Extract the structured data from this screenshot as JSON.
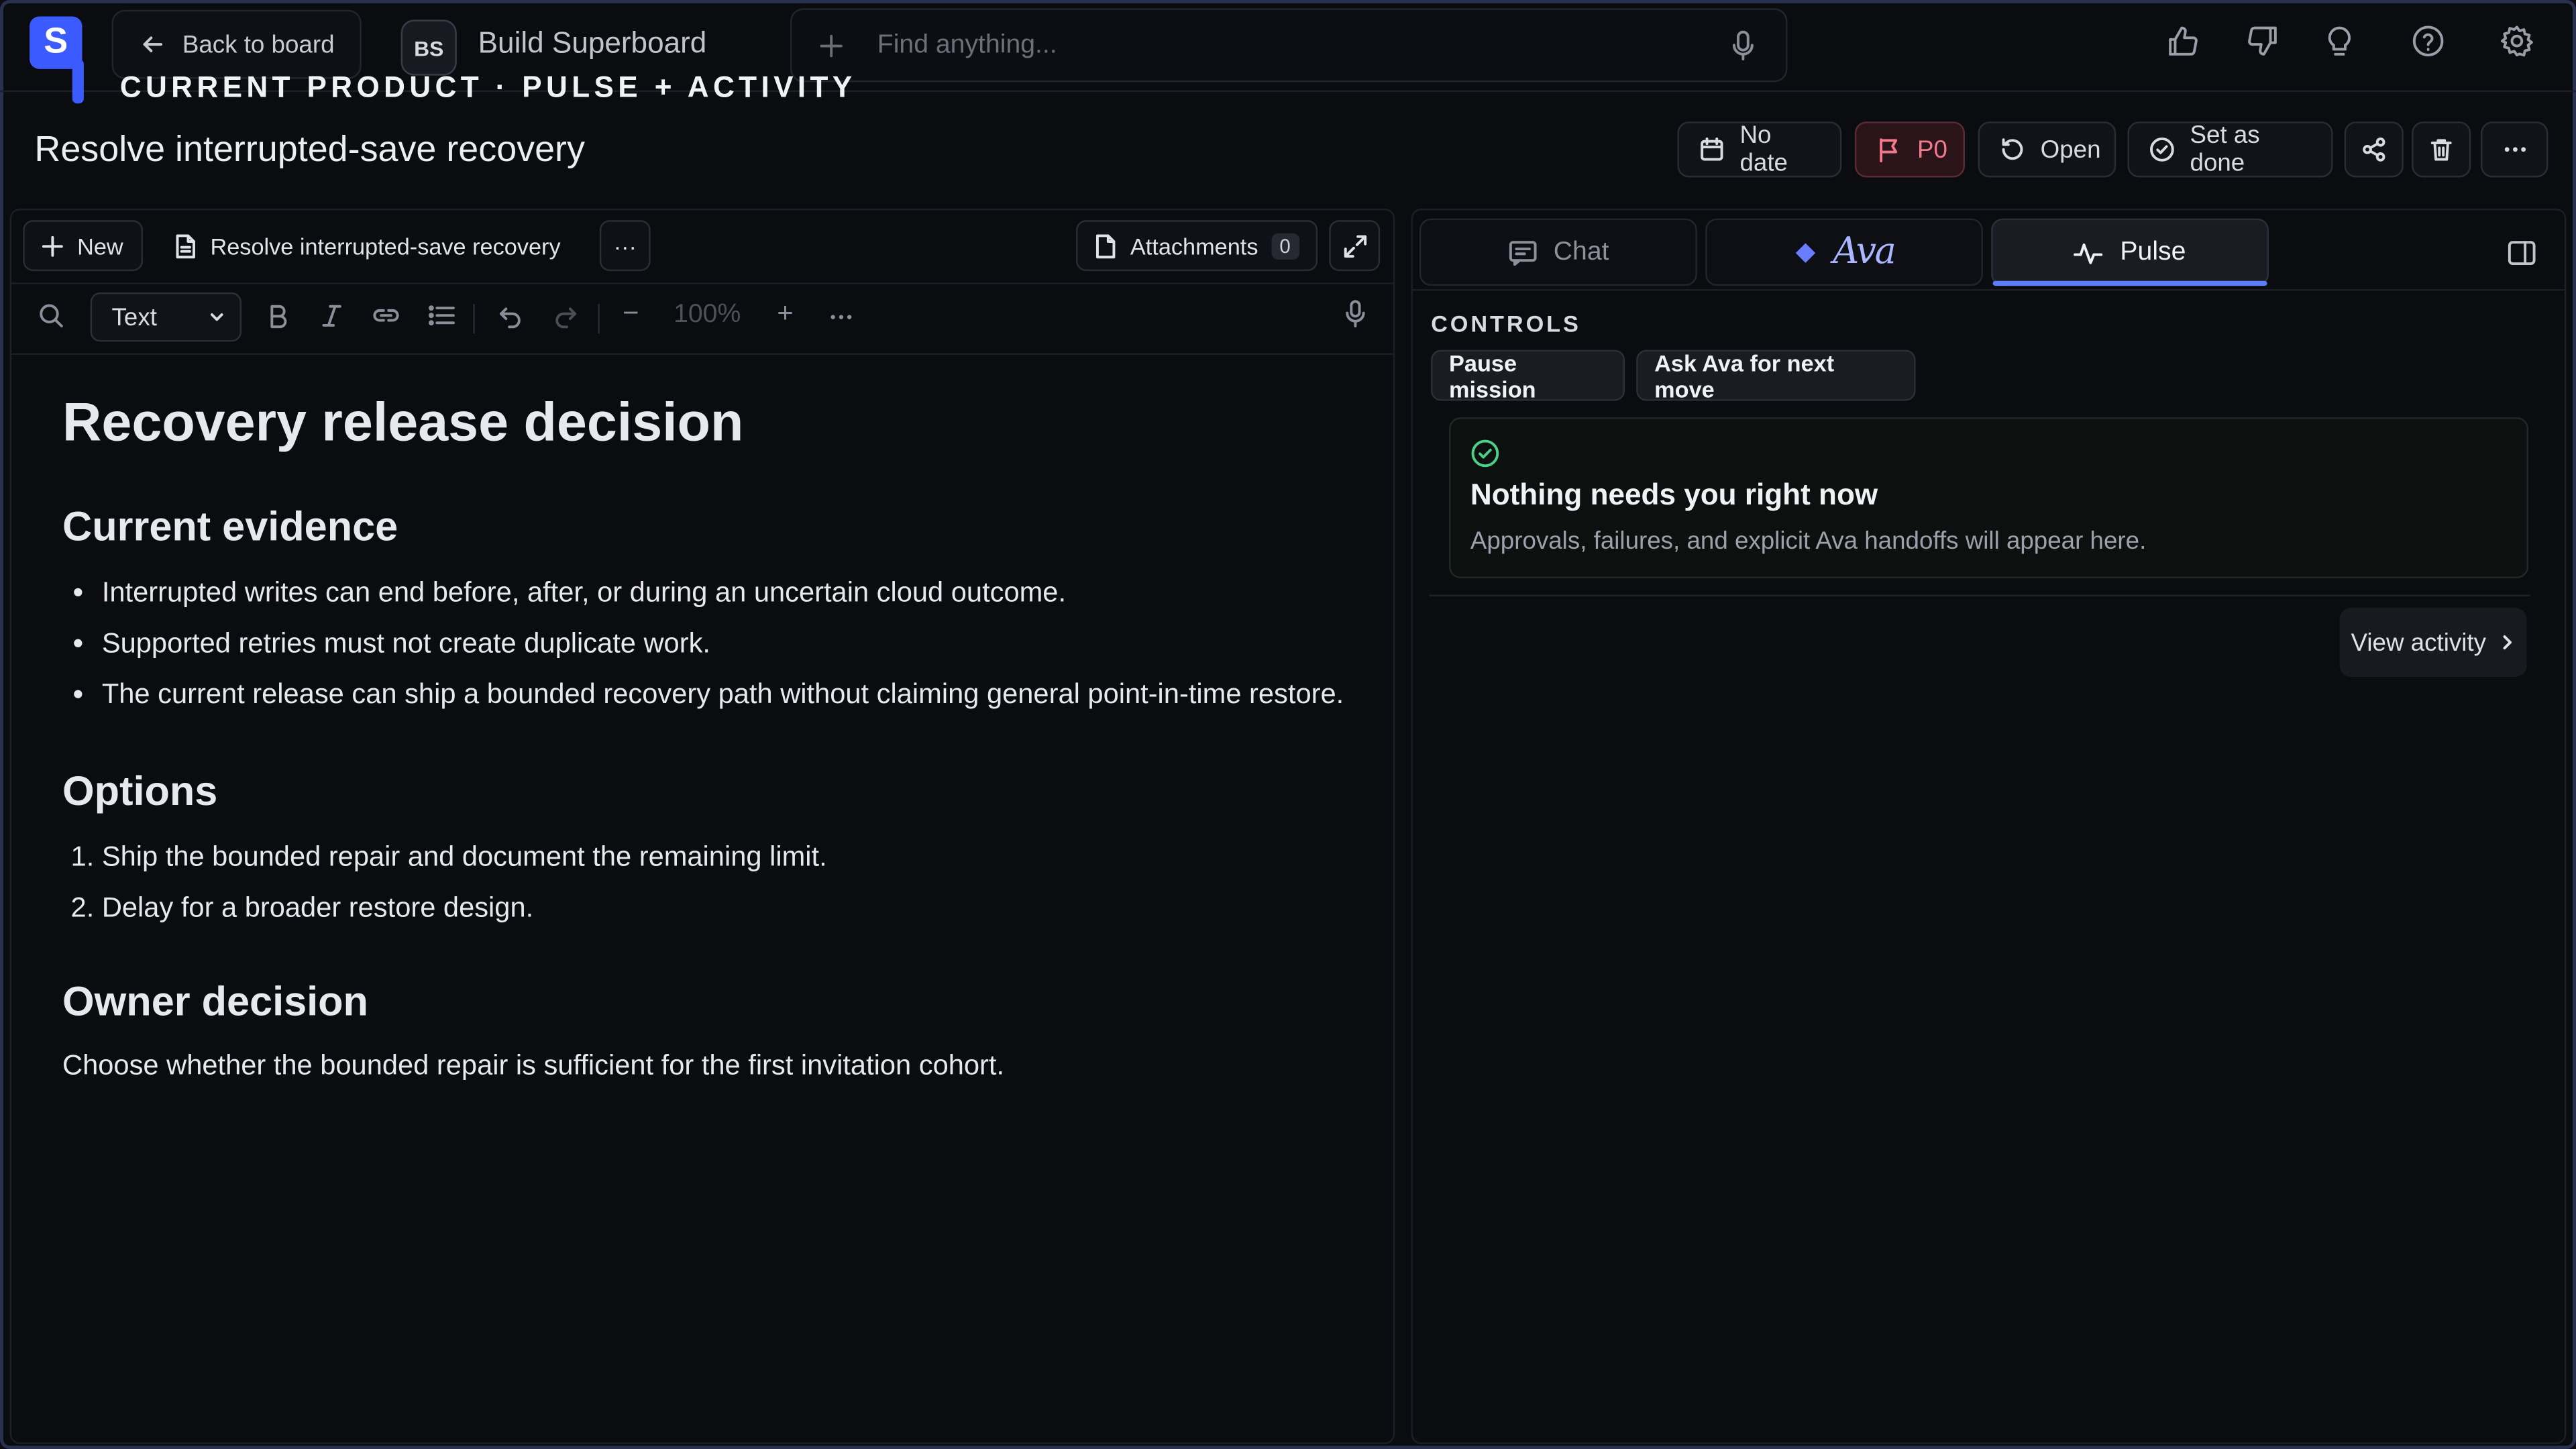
{
  "app": {
    "logo_letter": "S",
    "back_label": "Back to board",
    "project_initials": "BS",
    "project_name": "Build Superboard",
    "search_placeholder": "Find anything...",
    "section_label": "CURRENT PRODUCT · PULSE + ACTIVITY"
  },
  "task": {
    "title": "Resolve interrupted-save recovery",
    "date_label": "No date",
    "priority_label": "P0",
    "status_label": "Open",
    "done_label": "Set as done"
  },
  "editor": {
    "new_label": "New",
    "doc_tab_label": "Resolve interrupted-save recovery",
    "more_label": "···",
    "attachments_label": "Attachments",
    "attachments_count": "0",
    "format_select": "Text",
    "zoom_label": "100%",
    "zoom_minus": "−",
    "zoom_plus": "+"
  },
  "document": {
    "title": "Recovery release decision",
    "sections": [
      {
        "heading": "Current evidence",
        "bullets": [
          "Interrupted writes can end before, after, or during an uncertain cloud outcome.",
          "Supported retries must not create duplicate work.",
          "The current release can ship a bounded recovery path without claiming general point-in-time restore."
        ]
      },
      {
        "heading": "Options",
        "numbered": [
          "Ship the bounded repair and document the remaining limit.",
          "Delay for a broader restore design."
        ]
      },
      {
        "heading": "Owner decision",
        "paragraph": "Choose whether the bounded repair is sufficient for the first invitation cohort."
      }
    ]
  },
  "side": {
    "tabs": [
      {
        "label": "Chat"
      },
      {
        "label": "Ava"
      },
      {
        "label": "Pulse"
      }
    ],
    "controls_label": "CONTROLS",
    "pause_label": "Pause mission",
    "ask_label": "Ask Ava for next move",
    "card_title": "Nothing needs you right now",
    "card_sub": "Approvals, failures, and explicit Ava handoffs will appear here.",
    "view_activity_label": "View activity"
  },
  "colors": {
    "accent": "#3b5bff",
    "tab_underline": "#5b7cff",
    "priority": "#f07a8a",
    "success": "#4bd08a"
  }
}
